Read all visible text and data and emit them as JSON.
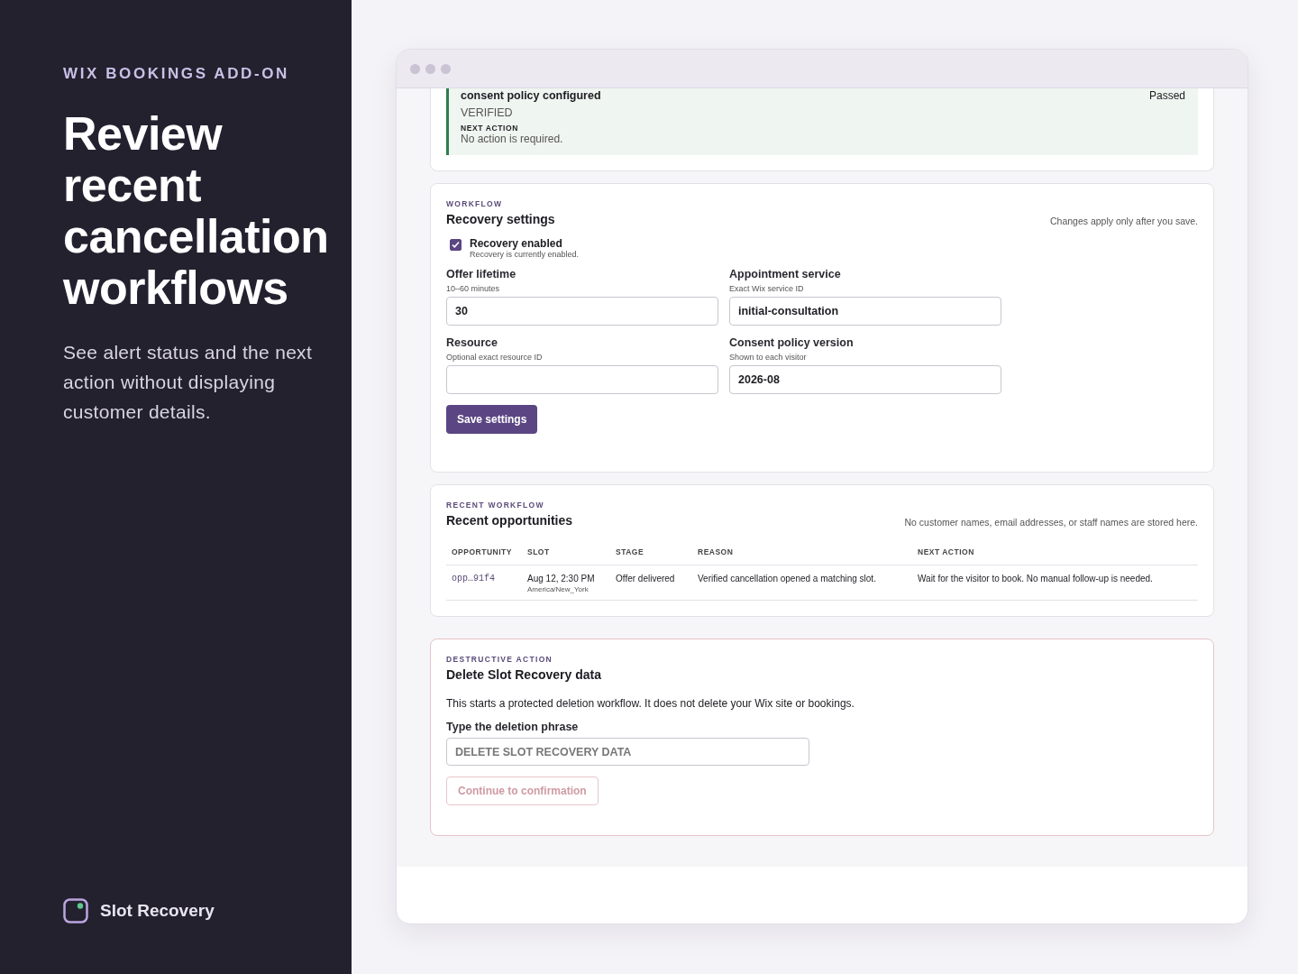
{
  "promo": {
    "eyebrow": "WIX BOOKINGS ADD-ON",
    "headline": "Review recent cancellation workflows",
    "description": "See alert status and the next action without displaying customer details.",
    "brand": "Slot Recovery"
  },
  "check": {
    "title": "consent policy configured",
    "result": "Passed",
    "status": "VERIFIED",
    "next_label": "NEXT ACTION",
    "next_text": "No action is required."
  },
  "settings": {
    "eyebrow": "WORKFLOW",
    "title": "Recovery settings",
    "note": "Changes apply only after you save.",
    "toggle": {
      "label": "Recovery enabled",
      "hint": "Recovery is currently enabled.",
      "checked": true
    },
    "fields": [
      {
        "label": "Offer lifetime",
        "hint": "10–60 minutes",
        "value": "30"
      },
      {
        "label": "Appointment service",
        "hint": "Exact Wix service ID",
        "value": "initial-consultation"
      },
      {
        "label": "Resource",
        "hint": "Optional exact resource ID"
      },
      {
        "label": "Consent policy version",
        "hint": "Shown to each visitor",
        "value": "2026-08"
      }
    ],
    "button": "Save settings"
  },
  "opportunities": {
    "eyebrow": "RECENT WORKFLOW",
    "title": "Recent opportunities",
    "note": "No customer names, email addresses, or staff names are stored here.",
    "columns": [
      "OPPORTUNITY",
      "SLOT",
      "STAGE",
      "REASON",
      "NEXT ACTION"
    ],
    "rows": [
      {
        "opportunity": "opp…91f4",
        "slot": "Aug 12, 2:30 PM",
        "timezone": "America/New_York",
        "stage": "Offer delivered",
        "reason": "Verified cancellation opened a matching slot.",
        "next_action": "Wait for the visitor to book. No manual follow-up is needed."
      }
    ]
  },
  "danger": {
    "eyebrow": "DESTRUCTIVE ACTION",
    "title": "Delete Slot Recovery data",
    "description": "This starts a protected deletion workflow. It does not delete your Wix site or bookings.",
    "field_label": "Type the deletion phrase",
    "placeholder": "DELETE SLOT RECOVERY DATA",
    "button": {
      "label": "Continue to confirmation",
      "disabled": true
    }
  }
}
